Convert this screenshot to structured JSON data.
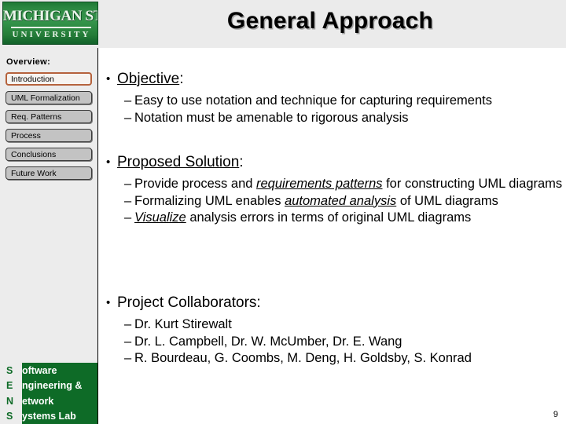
{
  "slide": {
    "title": "General Approach",
    "page_number": "9",
    "accent_green": "#0e6b27",
    "active_nav_border": "#b5623c",
    "header_background": "#ebebeb"
  },
  "logo": {
    "wordmark": "MICHIGAN STATE",
    "university": "UNIVERSITY"
  },
  "sidebar": {
    "heading": "Overview:",
    "items": [
      {
        "label": "Introduction",
        "state": "active"
      },
      {
        "label": "UML Formalization",
        "state": "inactive"
      },
      {
        "label": "Req. Patterns",
        "state": "inactive"
      },
      {
        "label": "Process",
        "state": "inactive"
      },
      {
        "label": "Conclusions",
        "state": "inactive"
      },
      {
        "label": "Future Work",
        "state": "inactive"
      }
    ]
  },
  "footer": {
    "rows": [
      {
        "initial": "S",
        "word": "oftware"
      },
      {
        "initial": "E",
        "word": "ngineering &"
      },
      {
        "initial": "N",
        "word": "etwork"
      },
      {
        "initial": "S",
        "word": "ystems Lab"
      }
    ]
  },
  "content": {
    "bullet_marker": "•",
    "dash_marker": "–",
    "objective": {
      "heading": "Objective",
      "heading_suffix": ":",
      "sub": [
        "Easy to use notation and technique for capturing requirements",
        "Notation must be amenable to rigorous analysis"
      ]
    },
    "proposed_solution": {
      "heading": "Proposed Solution",
      "heading_suffix": ":",
      "sub1_pre": "Provide process and ",
      "sub1_em": "requirements patterns",
      "sub1_post": " for constructing UML diagrams",
      "sub2_pre": "Formalizing UML enables ",
      "sub2_em": "automated analysis",
      "sub2_post": " of UML diagrams",
      "sub3_em": "Visualize",
      "sub3_post": " analysis errors in terms of original UML diagrams"
    },
    "collaborators": {
      "heading": "Project Collaborators",
      "heading_suffix": ":",
      "sub": [
        "Dr. Kurt Stirewalt",
        "Dr. L. Campbell, Dr. W. McUmber, Dr. E. Wang",
        "R. Bourdeau, G. Coombs, M. Deng, H. Goldsby, S. Konrad"
      ]
    }
  }
}
